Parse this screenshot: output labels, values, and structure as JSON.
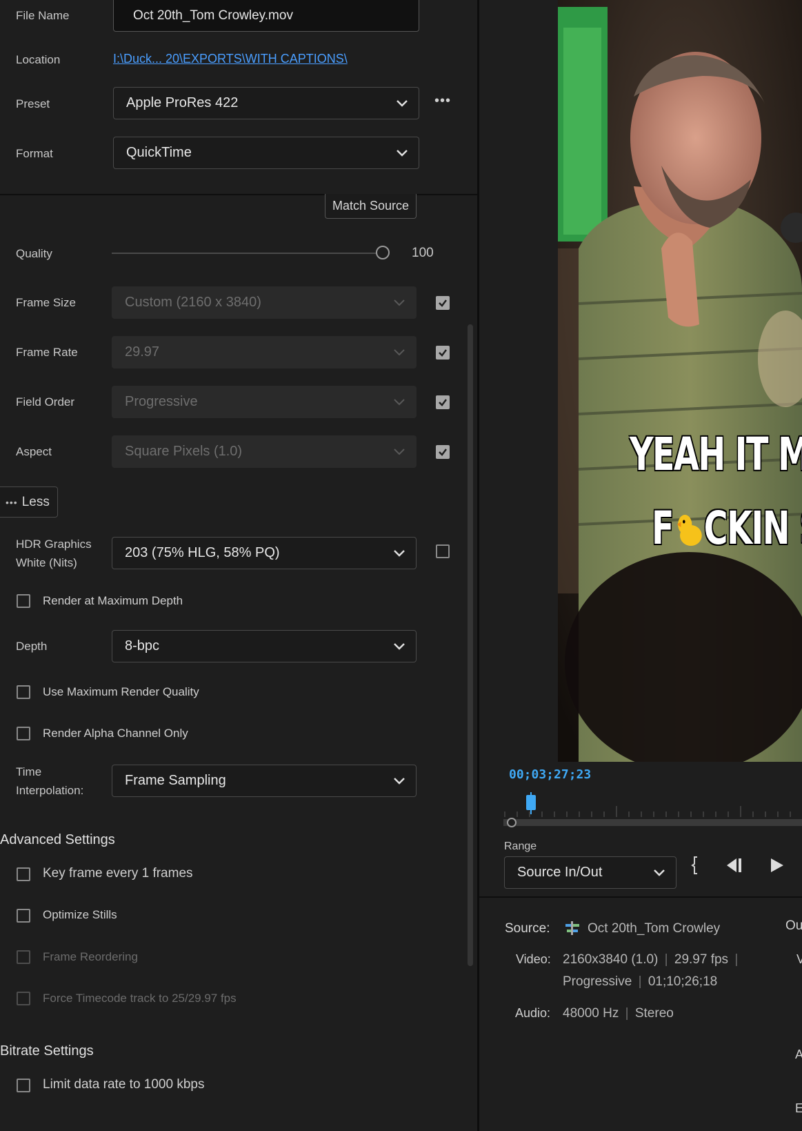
{
  "file_name": {
    "label": "File Name",
    "value": "Oct 20th_Tom Crowley.mov"
  },
  "location": {
    "label": "Location",
    "value": "I:\\Duck... 20\\EXPORTS\\WITH CAPTIONS\\"
  },
  "preset": {
    "label": "Preset",
    "value": "Apple ProRes 422",
    "more": "•••"
  },
  "format": {
    "label": "Format",
    "value": "QuickTime"
  },
  "match_source": "Match Source",
  "quality": {
    "label": "Quality",
    "value": "100",
    "fraction": 1.0
  },
  "frame_size": {
    "label": "Frame Size",
    "value": "Custom (2160 x 3840)",
    "checked": true
  },
  "frame_rate": {
    "label": "Frame Rate",
    "value": "29.97",
    "checked": true
  },
  "field_order": {
    "label": "Field Order",
    "value": "Progressive",
    "checked": true
  },
  "aspect": {
    "label": "Aspect",
    "value": "Square Pixels (1.0)",
    "checked": true
  },
  "less_button": "Less",
  "hdr": {
    "label_line1": "HDR Graphics",
    "label_line2": "White (Nits)",
    "value": "203 (75% HLG, 58% PQ)",
    "checked": false
  },
  "render_max_depth": "Render at Maximum Depth",
  "depth": {
    "label": "Depth",
    "value": "8-bpc"
  },
  "use_max_render_quality": "Use Maximum Render Quality",
  "render_alpha_only": "Render Alpha Channel Only",
  "time_interp": {
    "label_line1": "Time",
    "label_line2": "Interpolation:",
    "value": "Frame Sampling"
  },
  "advanced": {
    "title": "Advanced Settings",
    "key_frame": "Key frame every 1 frames",
    "optimize_stills": "Optimize Stills",
    "frame_reordering": "Frame Reordering",
    "force_timecode": "Force Timecode track to 25/29.97 fps"
  },
  "bitrate": {
    "title": "Bitrate Settings",
    "limit": "Limit data rate to 1000 kbps"
  },
  "preview": {
    "caption_line1": "YEAH IT MA",
    "caption_line2_a": "F",
    "caption_line2_b": "CKIN S",
    "timecode": "00;03;27;23"
  },
  "range": {
    "label": "Range",
    "value": "Source In/Out"
  },
  "source_info": {
    "source_label": "Source:",
    "source_name": "Oct 20th_Tom Crowley",
    "video_label": "Video:",
    "video_line1": "2160x3840 (1.0)",
    "video_fps": "29.97 fps",
    "video_scan": "Progressive",
    "video_duration": "01;10;26;18",
    "audio_label": "Audio:",
    "audio_rate": "48000 Hz",
    "audio_channels": "Stereo",
    "output_label_partial": "Ou",
    "partial_v": "V",
    "partial_a": "A",
    "partial_e": "E"
  },
  "colors": {
    "accent": "#3fa9f5",
    "link": "#4a9eff",
    "bg": "#1e1e1e"
  }
}
